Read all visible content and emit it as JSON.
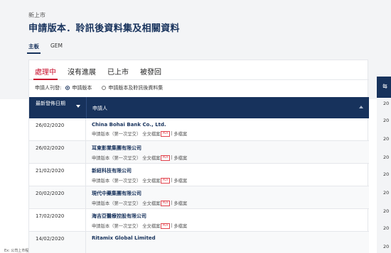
{
  "breadcrumb": "新上市",
  "page_title": "申請版本．聆訊後資料集及相關資料",
  "board_tabs": [
    {
      "label": "主板",
      "active": true
    },
    {
      "label": "GEM",
      "active": false
    }
  ],
  "status_tabs": [
    {
      "label": "處理中",
      "active": true
    },
    {
      "label": "沒有進展",
      "active": false
    },
    {
      "label": "已上市",
      "active": false
    },
    {
      "label": "被發回",
      "active": false
    }
  ],
  "filter": {
    "label": "申請人刊發:",
    "options": [
      {
        "label": "申請版本",
        "checked": true
      },
      {
        "label": "申請版本及聆訊後資料集",
        "checked": false
      }
    ]
  },
  "table": {
    "header_date": "最新發佈日期",
    "header_name": "申請人",
    "rows": [
      {
        "date": "26/02/2020",
        "company": "China Bohai Bank Co., Ltd.",
        "version": "申請版本（第一次呈交）",
        "full_doc": "全文檔案",
        "pdf": "PDF",
        "multi": "多檔案"
      },
      {
        "date": "26/02/2020",
        "company": "耳東影業集團有限公司",
        "version": "申請版本（第一次呈交）",
        "full_doc": "全文檔案",
        "pdf": "PDF",
        "multi": "多檔案"
      },
      {
        "date": "21/02/2020",
        "company": "新紐科技有限公司",
        "version": "申請版本（第一次呈交）",
        "full_doc": "全文檔案",
        "pdf": "PDF",
        "multi": "多檔案"
      },
      {
        "date": "20/02/2020",
        "company": "現代中藥集團有限公司",
        "version": "申請版本（第一次呈交）",
        "full_doc": "全文檔案",
        "pdf": "PDF",
        "multi": "多檔案"
      },
      {
        "date": "17/02/2020",
        "company": "海吉亞醫療控股有限公司",
        "version": "申請版本（第一次呈交）",
        "full_doc": "全文檔案",
        "pdf": "PDF",
        "multi": "多檔案"
      },
      {
        "date": "14/02/2020",
        "company": "Ritamix Global Limited",
        "version": "",
        "full_doc": "",
        "pdf": "",
        "multi": ""
      }
    ]
  },
  "right_panel": {
    "header": "每",
    "items": [
      "20",
      "20",
      "20",
      "20",
      "20",
      "20",
      "20",
      "20",
      "20"
    ]
  },
  "footer_text": "Ex: 公司上市程序"
}
